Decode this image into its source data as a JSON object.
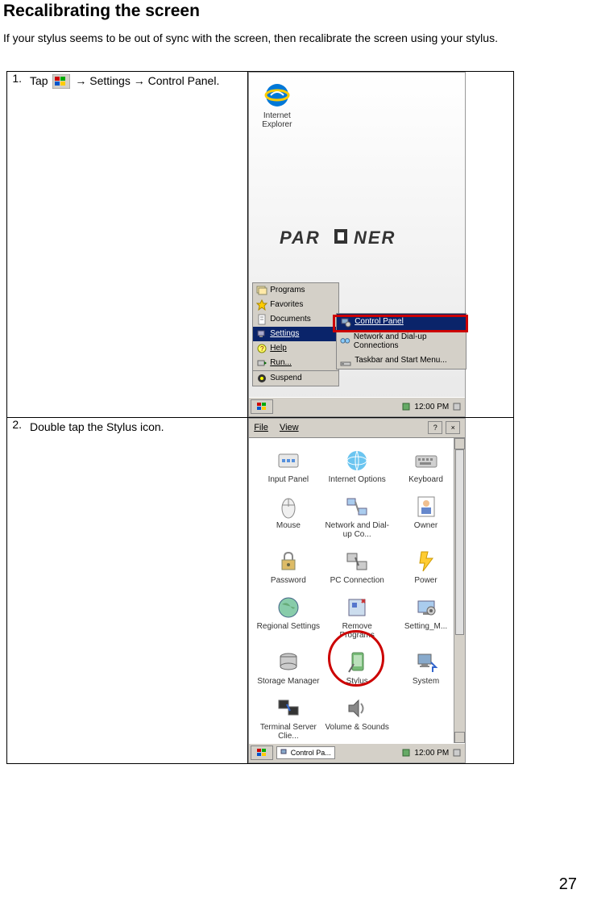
{
  "heading": "Recalibrating the screen",
  "intro": "If your stylus seems to be out of sync with the screen, then recalibrate the screen using your stylus.",
  "steps": [
    {
      "number": "1.",
      "before_icon": "Tap",
      "after_icon": " → Settings → Control Panel."
    },
    {
      "number": "2.",
      "text": "Double tap the Stylus icon."
    }
  ],
  "screenshot1": {
    "desktop_icon_label": "Internet\nExplorer",
    "logo_text": "PARTNER",
    "start_menu_items": [
      "Programs",
      "Favorites",
      "Documents",
      "Settings",
      "Help",
      "Run...",
      "Suspend"
    ],
    "submenu_items": [
      "Control Panel",
      "Network and Dial-up Connections",
      "Taskbar and Start Menu..."
    ],
    "taskbar_time": "12:00 PM"
  },
  "screenshot2": {
    "menu_file": "File",
    "menu_view": "View",
    "help_label": "?",
    "close_label": "×",
    "control_panel_items": [
      "Input Panel",
      "Internet Options",
      "Keyboard",
      "Mouse",
      "Network and Dial-up Co...",
      "Owner",
      "Password",
      "PC Connection",
      "Power",
      "Regional Settings",
      "Remove Programs",
      "Setting_M...",
      "Storage Manager",
      "Stylus",
      "System",
      "Terminal Server Clie...",
      "Volume & Sounds"
    ],
    "taskbar_app": "Control Pa...",
    "taskbar_time": "12:00 PM"
  },
  "page_number": "27"
}
